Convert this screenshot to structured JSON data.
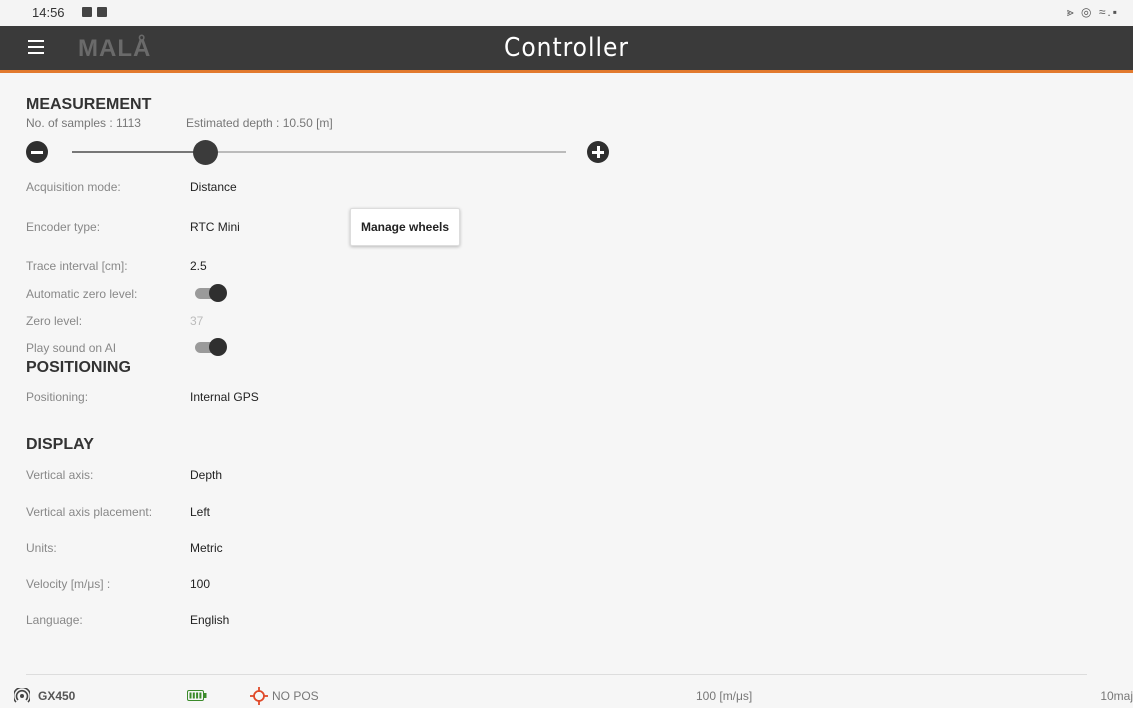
{
  "status_bar": {
    "time": "14:56",
    "right_icons": "⪢ ◎ ≈.▪"
  },
  "app_bar": {
    "logo": "MALÅ",
    "title": "Controller"
  },
  "measurement": {
    "title": "MEASUREMENT",
    "samples": "No. of samples : 1113",
    "depth": "Estimated depth : 10.50 [m]",
    "slider_fraction": 0.27,
    "rows": {
      "acquisition_mode": {
        "label": "Acquisition mode:",
        "value": "Distance"
      },
      "encoder_type": {
        "label": "Encoder type:",
        "value": "RTC Mini"
      },
      "trace_interval": {
        "label": "Trace interval [cm]:",
        "value": "2.5"
      },
      "auto_zero": {
        "label": "Automatic zero level:"
      },
      "zero_level": {
        "label": "Zero level:",
        "value": "37"
      },
      "play_sound": {
        "label": "Play sound on AI"
      }
    },
    "manage_wheels": "Manage wheels"
  },
  "positioning": {
    "title": "POSITIONING",
    "label": "Positioning:",
    "value": "Internal GPS"
  },
  "display": {
    "title": "DISPLAY",
    "rows": {
      "vertical_axis": {
        "label": "Vertical axis:",
        "value": "Depth"
      },
      "axis_placement": {
        "label": "Vertical axis placement:",
        "value": "Left"
      },
      "units": {
        "label": "Units:",
        "value": "Metric"
      },
      "velocity": {
        "label": "Velocity [m/μs] :",
        "value": "100"
      },
      "language": {
        "label": "Language:",
        "value": "English"
      }
    }
  },
  "footer": {
    "device": "GX450",
    "position": "NO POS",
    "velocity": "100 [m/μs]",
    "right": "10maj"
  },
  "colors": {
    "accent": "#e27a2e",
    "appbar": "#3a3a3a",
    "crosshair": "#e04a2a"
  }
}
